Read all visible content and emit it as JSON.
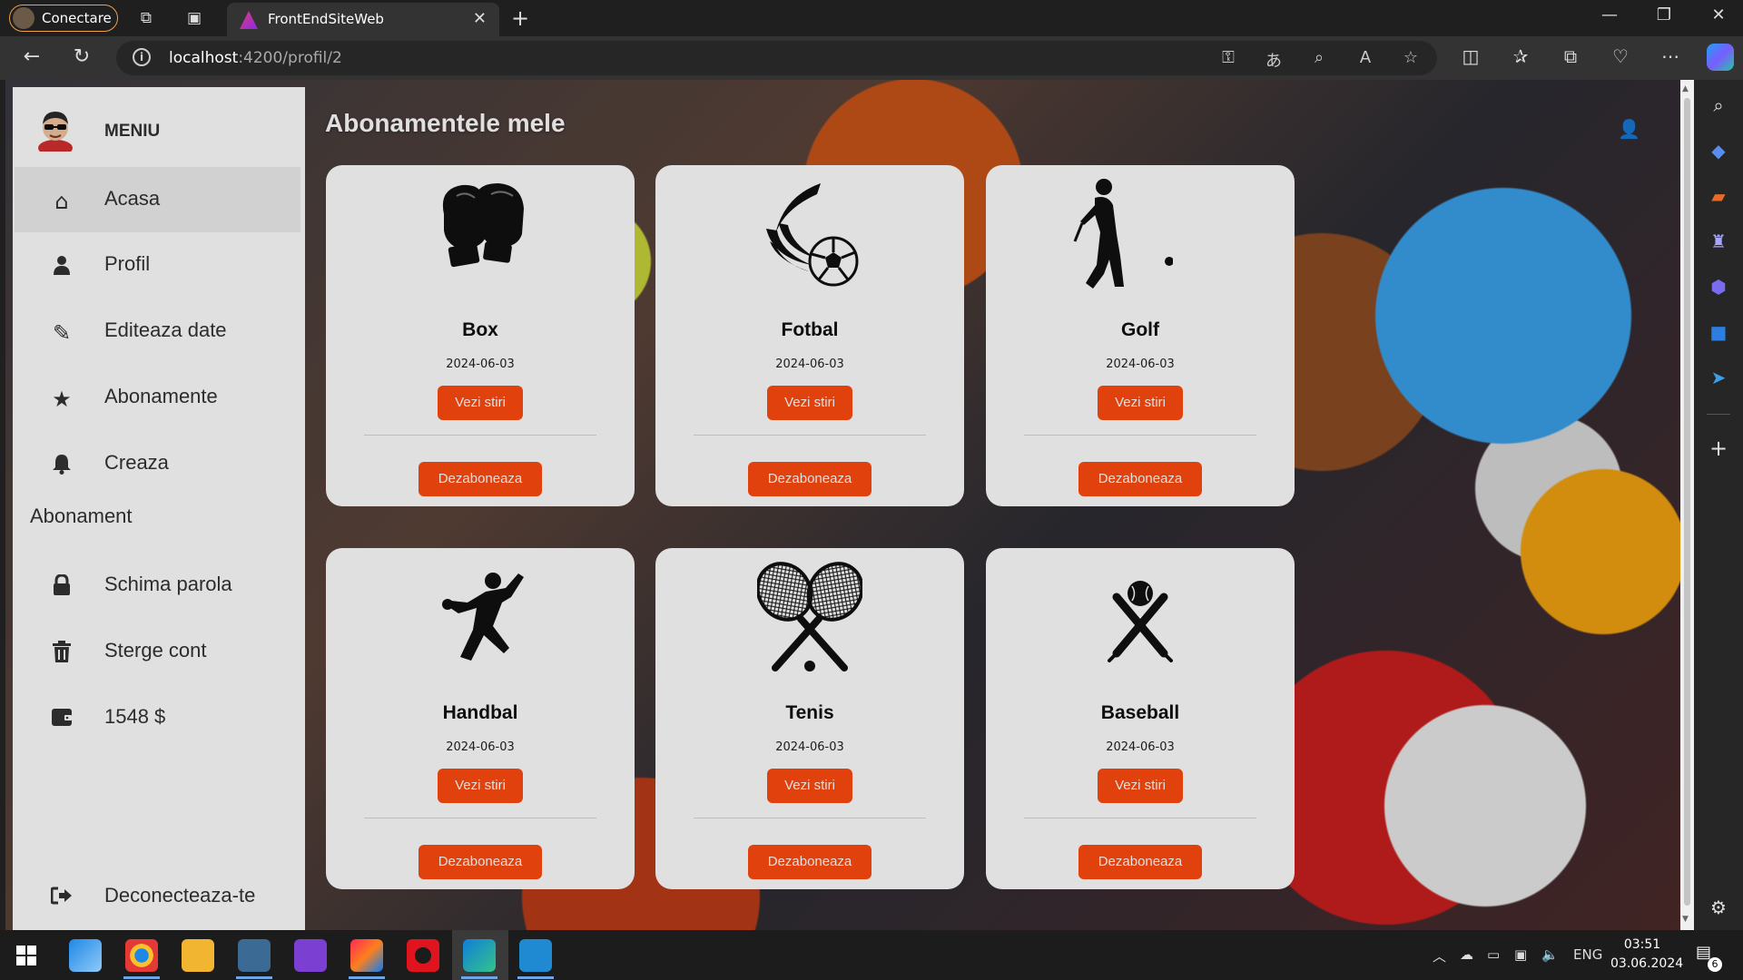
{
  "browser": {
    "profile_label": "Conectare",
    "tab_title": "FrontEndSiteWeb",
    "url_host": "localhost",
    "url_path": ":4200/profil/2"
  },
  "sidebar": {
    "title": "MENIU",
    "items": [
      {
        "label": "Acasa",
        "icon": "home-icon"
      },
      {
        "label": "Profil",
        "icon": "user-icon"
      },
      {
        "label": "Editeaza date",
        "icon": "pencil-icon"
      },
      {
        "label": "Abonamente",
        "icon": "star-icon"
      },
      {
        "label": "Creaza",
        "icon": "bell-icon"
      },
      {
        "label": "Schima parola",
        "icon": "lock-icon"
      },
      {
        "label": "Sterge cont",
        "icon": "trash-icon"
      },
      {
        "label": "1548 $",
        "icon": "wallet-icon"
      }
    ],
    "creaza_wrap": "Abonament",
    "logout_label": "Deconecteaza-te"
  },
  "main": {
    "title": "Abonamentele mele",
    "news_button": "Vezi stiri",
    "unsubscribe_button": "Dezaboneaza",
    "cards": [
      {
        "name": "Box",
        "date": "2024-06-03"
      },
      {
        "name": "Fotbal",
        "date": "2024-06-03"
      },
      {
        "name": "Golf",
        "date": "2024-06-03"
      },
      {
        "name": "Handbal",
        "date": "2024-06-03"
      },
      {
        "name": "Tenis",
        "date": "2024-06-03"
      },
      {
        "name": "Baseball",
        "date": "2024-06-03"
      }
    ]
  },
  "taskbar": {
    "language": "ENG",
    "time": "03:51",
    "date": "03.06.2024",
    "notifications": "6"
  },
  "colors": {
    "accent": "#ff4a0f",
    "sidebar_active": "#eeeeee"
  }
}
